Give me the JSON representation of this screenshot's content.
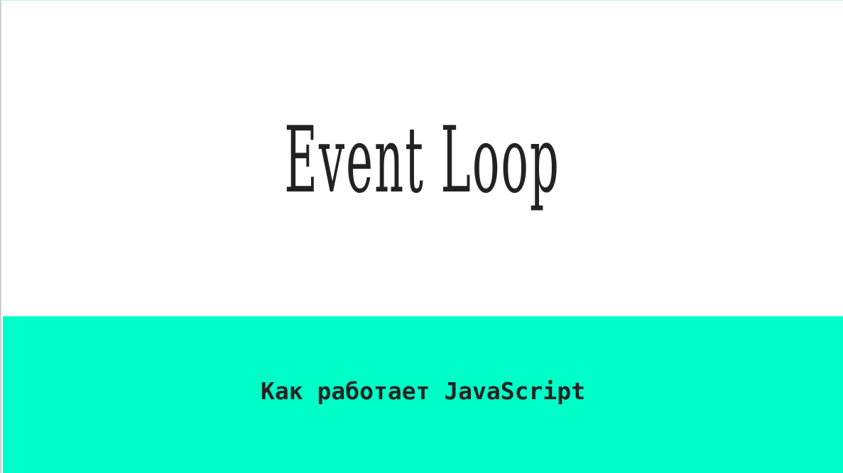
{
  "slide": {
    "title": "Event Loop",
    "subtitle": "Как работает JavaScript",
    "colors": {
      "accent_band": "#00fec8",
      "text": "#222222"
    }
  }
}
